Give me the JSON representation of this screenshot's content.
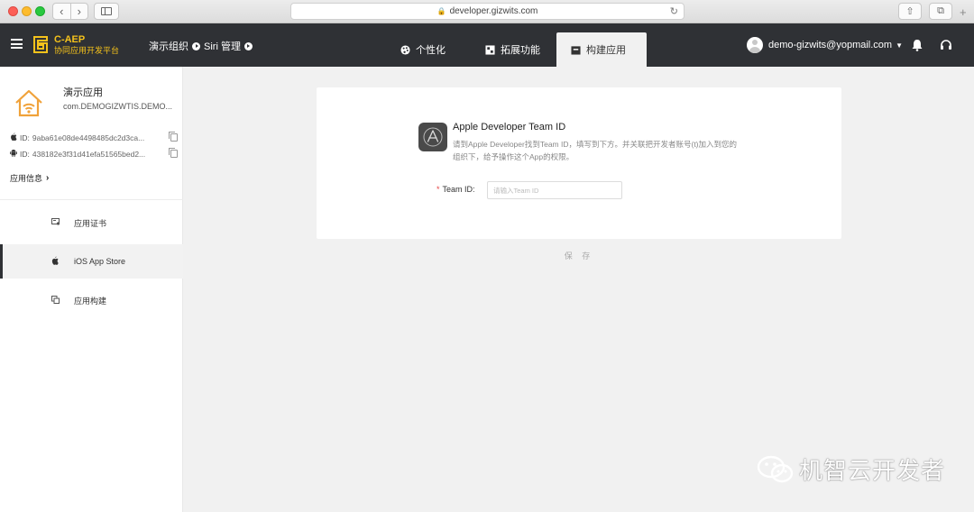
{
  "browser": {
    "url": "developer.gizwits.com",
    "back_icon": "‹",
    "forward_icon": "›"
  },
  "header": {
    "brand_name": "C-AEP",
    "brand_sub": "协同应用开发平台",
    "breadcrumb": [
      "演示组织",
      "Siri 管理"
    ],
    "tabs": [
      {
        "label": "个性化",
        "icon": "palette-icon"
      },
      {
        "label": "拓展功能",
        "icon": "puzzle-icon"
      },
      {
        "label": "构建应用",
        "icon": "build-icon"
      }
    ],
    "active_tab": "构建应用",
    "user_email": "demo-gizwits@yopmail.com",
    "accent_color": "#f5c21b",
    "bg_color": "#2f3135"
  },
  "sidebar": {
    "app_name": "演示应用",
    "bundle_id": "com.DEMOGIZWTIS.DEMO...",
    "ios_id_label": "ID:",
    "ios_id": "9aba61e08de4498485dc2d3ca...",
    "android_id_label": "ID:",
    "android_id": "438182e3f31d41efa51565bed2...",
    "app_info": "应用信息",
    "items": [
      {
        "label": "应用证书",
        "icon": "certificate-icon"
      },
      {
        "label": "iOS App Store",
        "icon": "apple-icon"
      },
      {
        "label": "应用构建",
        "icon": "copy-icon"
      }
    ]
  },
  "main": {
    "title": "Apple Developer Team ID",
    "description": "请到Apple Developer找到Team ID，填写到下方。并关联把开发者账号(t)加入到您的组织下，给予操作这个App的权限。",
    "field_label": "Team ID:",
    "field_required": "*",
    "field_placeholder": "请输入Team ID",
    "field_value": "",
    "save_label": "保 存"
  },
  "watermark": {
    "text": "机智云开发者"
  }
}
